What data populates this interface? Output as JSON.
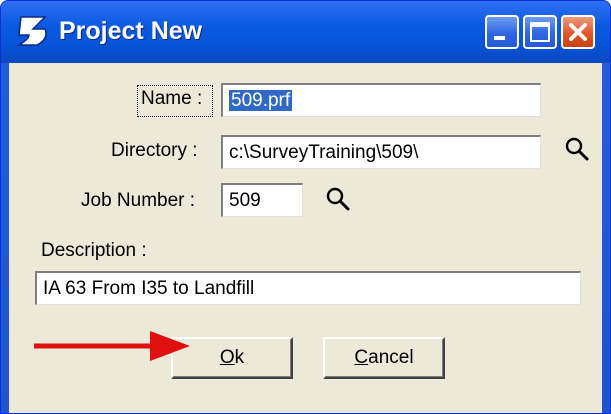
{
  "window": {
    "title": "Project New",
    "controls": [
      "minimize-icon",
      "maximize-icon",
      "close-icon"
    ]
  },
  "form": {
    "name_label": "Name :",
    "name_value": "509.prf",
    "directory_label": "Directory :",
    "directory_value": "c:\\SurveyTraining\\509\\",
    "job_number_label": "Job Number :",
    "job_number_value": "509",
    "description_label": "Description :",
    "description_value": "IA 63 From I35 to Landfill"
  },
  "buttons": {
    "ok_mnemonic": "O",
    "ok_rest": "k",
    "cancel_mnemonic": "C",
    "cancel_rest": "ancel"
  },
  "colors": {
    "title_bar": "#0653d6",
    "selection": "#316ac5",
    "annotation_arrow": "#e01010"
  }
}
